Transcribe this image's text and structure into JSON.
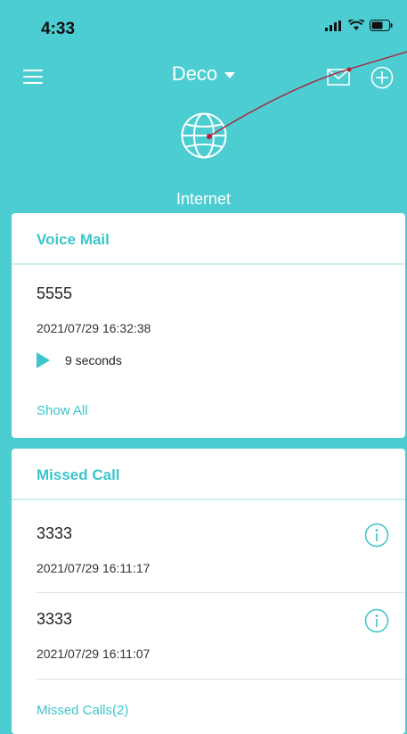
{
  "status_bar": {
    "time": "4:33"
  },
  "nav": {
    "title": "Deco"
  },
  "hero": {
    "label": "Internet"
  },
  "voice_mail": {
    "title": "Voice Mail",
    "items": [
      {
        "name": "5555",
        "date": "2021/07/29 16:32:38",
        "duration": "9 seconds"
      }
    ],
    "link": "Show All"
  },
  "missed_call": {
    "title": "Missed Call",
    "items": [
      {
        "name": "3333",
        "date": "2021/07/29 16:11:17"
      },
      {
        "name": "3333",
        "date": "2021/07/29 16:11:07"
      }
    ],
    "link": "Missed Calls(2)"
  },
  "colors": {
    "background": "#4ccdd2",
    "accent": "#3cc5cc",
    "arrow": "#b0203a"
  }
}
